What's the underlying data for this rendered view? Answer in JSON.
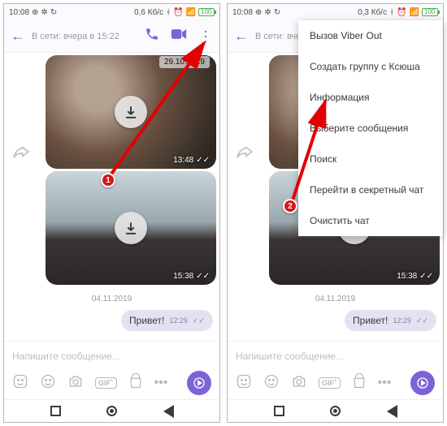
{
  "status": {
    "time": "10:08",
    "net_left": "0,6 Кб/с",
    "net_right": "0,3 Кб/с",
    "battery": "100"
  },
  "header": {
    "presence": "В сети: вчера в 15:22",
    "presence_short": "В сети: вчера"
  },
  "dates": {
    "stamp1": "29.10.2019",
    "center": "04.11.2019"
  },
  "times": {
    "img1": "13:48",
    "img2": "15:38",
    "bubble": "12:29"
  },
  "bubble": {
    "text": "Привет!"
  },
  "input": {
    "placeholder": "Напишите сообщение..."
  },
  "menu": {
    "items": [
      "Вызов Viber Out",
      "Создать группу с Ксюша",
      "Информация",
      "Выберите сообщения",
      "Поиск",
      "Перейти в секретный чат",
      "Очистить чат"
    ]
  },
  "badges": {
    "b1": "1",
    "b2": "2"
  }
}
